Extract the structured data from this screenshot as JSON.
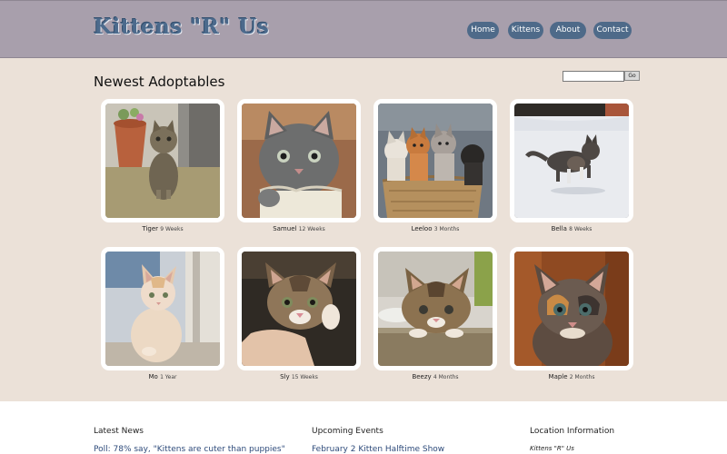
{
  "header": {
    "logo": "Kittens \"R\" Us",
    "nav": [
      {
        "label": "Home"
      },
      {
        "label": "Kittens"
      },
      {
        "label": "About"
      },
      {
        "label": "Contact"
      }
    ]
  },
  "main": {
    "title": "Newest Adoptables",
    "search": {
      "value": "",
      "button_label": "Go"
    },
    "kittens": [
      {
        "name": "Tiger",
        "age": "9 Weeks"
      },
      {
        "name": "Samuel",
        "age": "12 Weeks"
      },
      {
        "name": "Leeloo",
        "age": "3 Months"
      },
      {
        "name": "Bella",
        "age": "8 Weeks"
      },
      {
        "name": "Mo",
        "age": "1 Year"
      },
      {
        "name": "Sly",
        "age": "15 Weeks"
      },
      {
        "name": "Beezy",
        "age": "4 Months"
      },
      {
        "name": "Maple",
        "age": "2 Months"
      }
    ]
  },
  "footer": {
    "news": {
      "heading": "Latest News",
      "item": "Poll: 78% say, \"Kittens are cuter than puppies\""
    },
    "events": {
      "heading": "Upcoming Events",
      "item": "February 2 Kitten Halftime Show"
    },
    "location": {
      "heading": "Location Information",
      "item": "Kittens \"R\" Us"
    }
  },
  "colors": {
    "header_bg": "#a89fac",
    "nav_button": "#4e6a89",
    "logo": "#4c6a8c",
    "content_bg": "#ebe1d8",
    "link": "#2d4a7a"
  }
}
